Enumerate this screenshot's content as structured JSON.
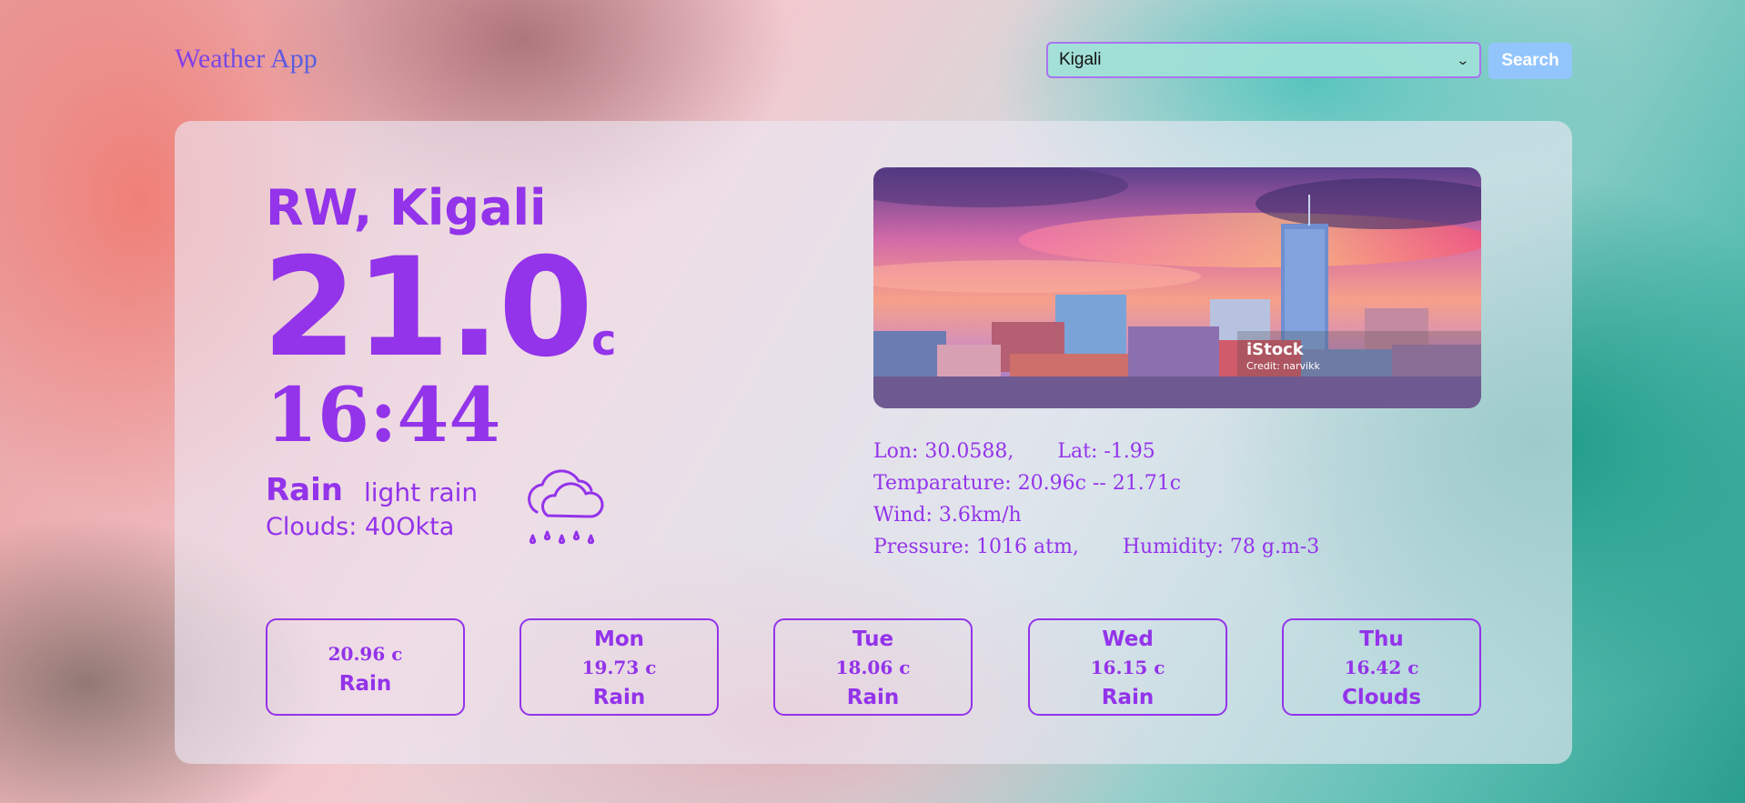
{
  "app": {
    "title": "Weather App"
  },
  "search": {
    "selected_city": "Kigali",
    "button_label": "Search"
  },
  "current": {
    "location": "RW, Kigali",
    "temperature": "21.0",
    "temperature_unit": "c",
    "time": "16:44",
    "condition": "Rain",
    "description": "light rain",
    "clouds": "Clouds: 40Okta",
    "icon": "rain-cloud-icon"
  },
  "image": {
    "brand": "iStock",
    "credit": "Credit: narvikk"
  },
  "details": {
    "lon": "Lon: 30.0588,",
    "lat": "Lat: -1.95",
    "temperature_range": "Temparature: 20.96c -- 21.71c",
    "wind": "Wind: 3.6km/h",
    "pressure": "Pressure: 1016 atm,",
    "humidity": "Humidity: 78 g.m-3"
  },
  "forecast": [
    {
      "day": "",
      "temp": "20.96 c",
      "condition": "Rain"
    },
    {
      "day": "Mon",
      "temp": "19.73 c",
      "condition": "Rain"
    },
    {
      "day": "Tue",
      "temp": "18.06 c",
      "condition": "Rain"
    },
    {
      "day": "Wed",
      "temp": "16.15 c",
      "condition": "Rain"
    },
    {
      "day": "Thu",
      "temp": "16.42 c",
      "condition": "Clouds"
    }
  ],
  "colors": {
    "accent": "#9333ea",
    "button": "#93c5fd",
    "select_bg": "#a0e1d7",
    "card_bg": "#ece8f4"
  }
}
